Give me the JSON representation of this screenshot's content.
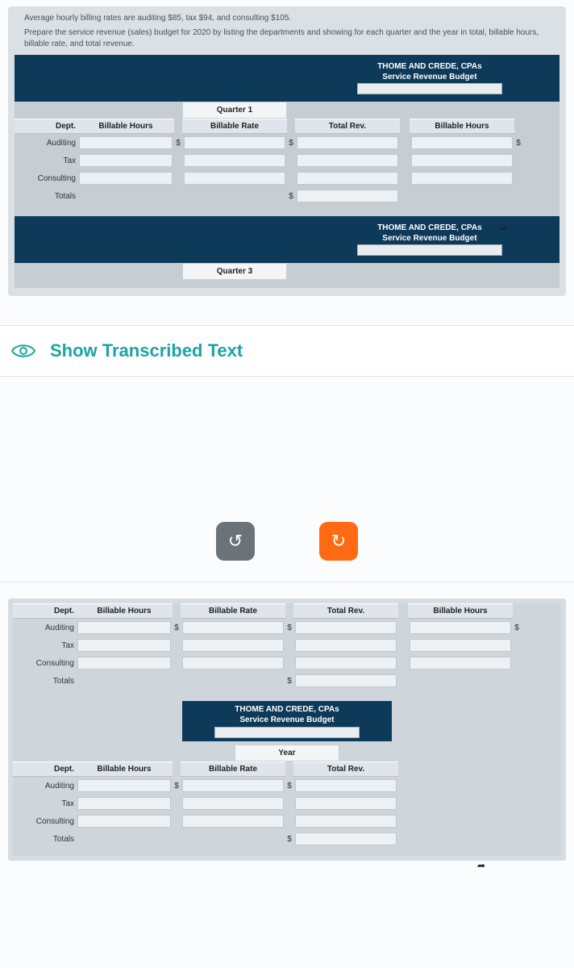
{
  "instructions": {
    "line1": "Average hourly billing rates are auditing $85, tax $94, and consulting $105.",
    "line2": "Prepare the service revenue (sales) budget for 2020 by listing the departments and showing for each quarter and the year in total, billable hours, billable rate, and total revenue."
  },
  "banner": {
    "title1": "THOME AND CREDE, CPAs",
    "title2": "Service Revenue Budget"
  },
  "columns": {
    "dept": "Dept.",
    "hours": "Billable Hours",
    "rate": "Billable Rate",
    "rev": "Total Rev.",
    "hours2": "Billable Hours"
  },
  "quarters": {
    "q1": "Quarter 1",
    "q3": "Quarter 3",
    "year": "Year"
  },
  "rows": {
    "auditing": "Auditing",
    "tax": "Tax",
    "consulting": "Consulting",
    "totals": "Totals"
  },
  "currency": "$",
  "show_transcribed": "Show Transcribed Text",
  "icons": {
    "undo": "↺",
    "redo": "↻"
  }
}
